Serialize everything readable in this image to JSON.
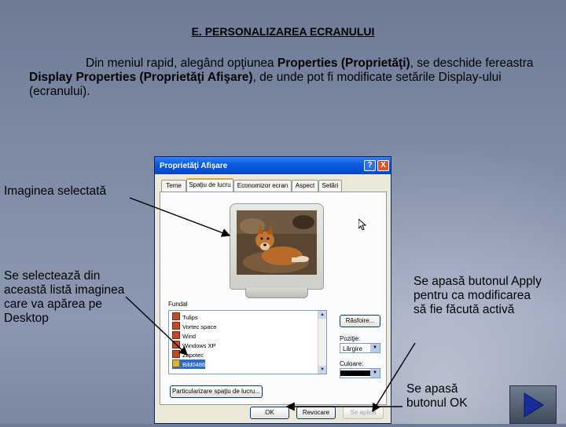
{
  "slide": {
    "title": "E. PERSONALIZAREA ECRANULUI",
    "intro_parts": [
      "Din meniul rapid, alegând opţiunea ",
      "Properties (Proprietăţi)",
      ", se deschide fereastra ",
      "Display Properties (Proprietăţi Afişare)",
      ", de unde pot fi modificate setările Display-ului (ecranului)."
    ]
  },
  "dialog": {
    "title": "Proprietăţi Afişare",
    "help_label": "?",
    "close_label": "X",
    "tabs": [
      "Teme",
      "Spaţiu de lucru",
      "Economizor ecran",
      "Aspect",
      "Setări"
    ],
    "active_tab": 1,
    "background_label": "Fundal",
    "background_list": [
      "Tulips",
      "Vortec space",
      "Wind",
      "Windows XP",
      "Zapotec",
      "Bild0486"
    ],
    "selected_item": "Bild0486",
    "browse_button": "Răsfoire...",
    "position_label": "Poziţie:",
    "position_value": "Lărgire",
    "color_label": "Culoare:",
    "customize_button": "Particularizare spaţiu de lucru...",
    "ok_button": "OK",
    "cancel_button": "Revocare",
    "apply_button": "Se aplică"
  },
  "annotations": {
    "selected_image": "Imaginea selectată",
    "list_select": "Se selectează din această listă imaginea care va apărea pe Desktop",
    "apply_note": "Se apasă butonul Apply pentru ca modificarea să fie făcută activă",
    "ok_note": "Se apasă butonul OK"
  },
  "colors": {
    "title_bar": "#0548c8",
    "selection": "#316ac5",
    "background_slide": "#7f8ca6"
  },
  "icons": {
    "cursor": "mouse-pointer-icon",
    "next": "play-next-icon"
  }
}
